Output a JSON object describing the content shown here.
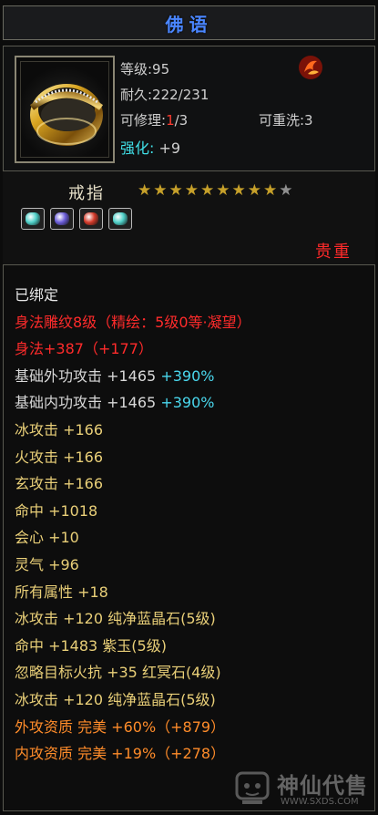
{
  "title": "佛语",
  "item": {
    "name": "戒指",
    "rarity": "贵重",
    "stars_filled": 9,
    "stars_total": 10
  },
  "header": {
    "level": "等级:95",
    "durability": "耐久:222/231",
    "repair_label": "可修理:",
    "repair_current": "1",
    "repair_max": "/3",
    "rewash": "可重洗:3",
    "enhance_label": "强化:",
    "enhance_value": "+9"
  },
  "gems": [
    "#4fd0c8",
    "#6a5cd8",
    "#d33a2a",
    "#4fd0c8"
  ],
  "attributes": [
    {
      "segments": [
        {
          "text": "已绑定",
          "color": "white"
        }
      ]
    },
    {
      "segments": [
        {
          "text": "身法雕纹8级（精绘：5级0等·凝望）",
          "color": "red"
        }
      ]
    },
    {
      "segments": [
        {
          "text": "身法+387（+177）",
          "color": "red"
        }
      ]
    },
    {
      "segments": [
        {
          "text": "基础外功攻击 +1465 ",
          "color": "gray"
        },
        {
          "text": "+390%",
          "color": "cyan"
        }
      ]
    },
    {
      "segments": [
        {
          "text": "基础内功攻击 +1465 ",
          "color": "gray"
        },
        {
          "text": "+390%",
          "color": "cyan"
        }
      ]
    },
    {
      "segments": [
        {
          "text": "冰攻击 +166",
          "color": "gold"
        }
      ]
    },
    {
      "segments": [
        {
          "text": "火攻击 +166",
          "color": "gold"
        }
      ]
    },
    {
      "segments": [
        {
          "text": "玄攻击 +166",
          "color": "gold"
        }
      ]
    },
    {
      "segments": [
        {
          "text": "命中 +1018",
          "color": "gold"
        }
      ]
    },
    {
      "segments": [
        {
          "text": "会心 +10",
          "color": "gold"
        }
      ]
    },
    {
      "segments": [
        {
          "text": "灵气 +96",
          "color": "gold"
        }
      ]
    },
    {
      "segments": [
        {
          "text": "所有属性 +18",
          "color": "gold"
        }
      ]
    },
    {
      "segments": [
        {
          "text": "冰攻击 +120 纯净蓝晶石(5级)",
          "color": "gold"
        }
      ]
    },
    {
      "segments": [
        {
          "text": "命中 +1483 紫玉(5级)",
          "color": "gold"
        }
      ]
    },
    {
      "segments": [
        {
          "text": "忽略目标火抗 +35 红冥石(4级)",
          "color": "gold"
        }
      ]
    },
    {
      "segments": [
        {
          "text": "冰攻击 +120 纯净蓝晶石(5级)",
          "color": "gold"
        }
      ]
    },
    {
      "segments": [
        {
          "text": "外攻资质  完美 +60%（+879）",
          "color": "orange"
        }
      ]
    },
    {
      "segments": [
        {
          "text": "内攻资质  完美 +19%（+278）",
          "color": "orange"
        }
      ]
    }
  ],
  "watermark": {
    "brand": "神仙代售",
    "url": "WWW.SXDS.COM"
  },
  "icons": [
    "ring-item-icon",
    "bind-badge-icon",
    "star-icon",
    "gem-icon",
    "watermark-logo-icon"
  ]
}
